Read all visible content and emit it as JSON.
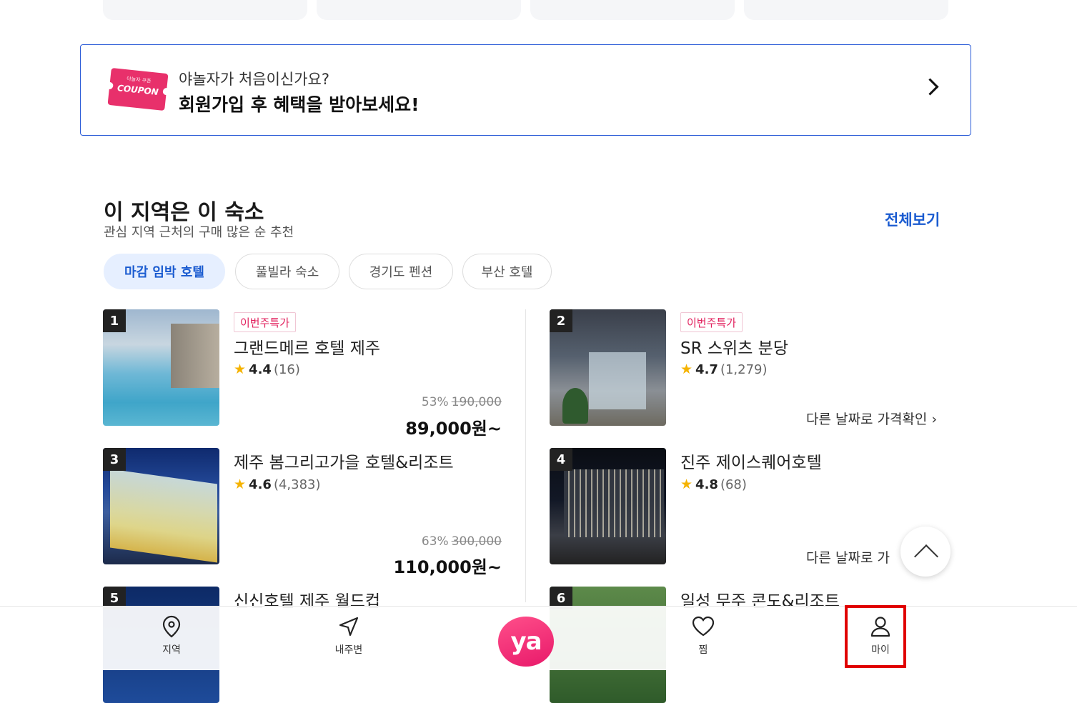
{
  "banner": {
    "coupon_small": "야놀자 쿠폰",
    "coupon_big": "COUPON",
    "subtitle": "야놀자가 처음이신가요?",
    "title": "회원가입 후 혜택을 받아보세요!"
  },
  "section": {
    "title": "이 지역은 이 숙소",
    "subtitle": "관심 지역 근처의 구매 많은 순 추천",
    "view_all": "전체보기",
    "chips": [
      "마감 임박 호텔",
      "풀빌라 숙소",
      "경기도 펜션",
      "부산 호텔"
    ],
    "active_chip": "마감 임박 호텔"
  },
  "listings": [
    {
      "rank": "1",
      "badge": "이번주특가",
      "name": "그랜드메르 호텔 제주",
      "score": "4.4",
      "count": "(16)",
      "discount": "53%",
      "original_price": "190,000",
      "price": "89,000원~"
    },
    {
      "rank": "2",
      "badge": "이번주특가",
      "name": "SR 스위츠 분당",
      "score": "4.7",
      "count": "(1,279)",
      "other_date": "다른 날짜로 가격확인"
    },
    {
      "rank": "3",
      "name": "제주 봄그리고가을 호텔&리조트",
      "score": "4.6",
      "count": "(4,383)",
      "discount": "63%",
      "original_price": "300,000",
      "price": "110,000원~"
    },
    {
      "rank": "4",
      "name": "진주 제이스퀘어호텔",
      "score": "4.8",
      "count": "(68)",
      "other_date": "다른 날짜로 가"
    },
    {
      "rank": "5",
      "name": "신신호텔 제주 월드컵"
    },
    {
      "rank": "6",
      "name": "일성 무주 콘도&리조트"
    }
  ],
  "bottom_nav": {
    "region": "지역",
    "nearby": "내주변",
    "home_logo": "ya",
    "wishlist": "찜",
    "my": "마이"
  },
  "icons": {
    "nav_region": "location-pin-icon",
    "nav_nearby": "navigation-arrow-icon",
    "nav_wishlist": "heart-icon",
    "nav_my": "user-icon",
    "scroll_top": "chevron-up-icon"
  },
  "colors": {
    "accent_blue": "#1a5bd0",
    "brand_pink": "#e8196a",
    "highlight_red": "#e00000"
  }
}
